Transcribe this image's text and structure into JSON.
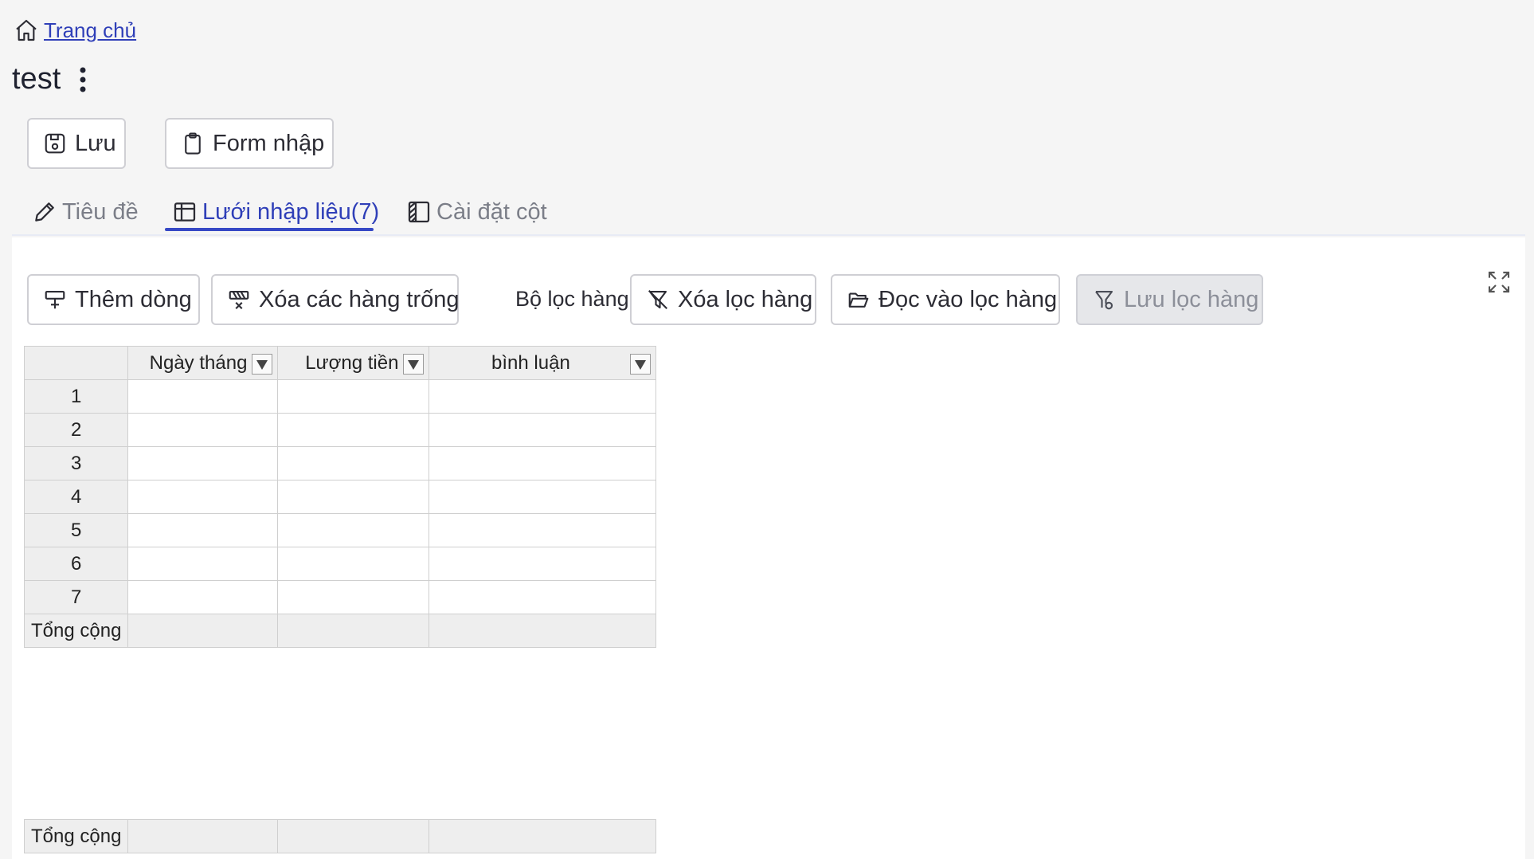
{
  "breadcrumb": {
    "home_label": "Trang chủ",
    "icon": "home-icon"
  },
  "page": {
    "title": "test",
    "menu_icon": "kebab-menu-icon"
  },
  "toolbar": {
    "save_label": "Lưu",
    "form_label": "Form nhập"
  },
  "tabs": [
    {
      "label": "Tiêu đề",
      "icon": "pencil-icon",
      "active": false
    },
    {
      "label": "Lưới nhập liệu(7)",
      "icon": "table-icon",
      "active": true
    },
    {
      "label": "Cài đặt cột",
      "icon": "column-settings-icon",
      "active": false
    }
  ],
  "grid_toolbar": {
    "add_row": "Thêm dòng",
    "delete_empty_rows": "Xóa các hàng trống",
    "row_filter_label": "Bộ lọc hàng",
    "clear_filter": "Xóa lọc hàng",
    "load_filter": "Đọc vào lọc hàng",
    "save_filter": "Lưu lọc hàng"
  },
  "grid": {
    "columns": [
      "Ngày tháng",
      "Lượng tiền",
      "bình luận"
    ],
    "rows": [
      "1",
      "2",
      "3",
      "4",
      "5",
      "6",
      "7"
    ],
    "total_label": "Tổng cộng"
  },
  "colors": {
    "accent": "#3648c5",
    "link": "#2f3fb8",
    "background": "#f5f5f5"
  }
}
